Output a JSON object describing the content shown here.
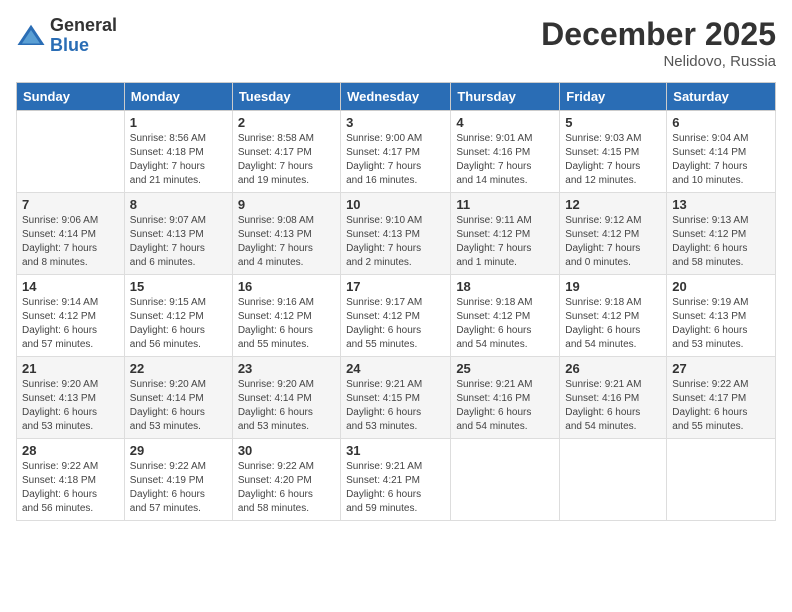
{
  "header": {
    "logo_general": "General",
    "logo_blue": "Blue",
    "month_title": "December 2025",
    "location": "Nelidovo, Russia"
  },
  "columns": [
    "Sunday",
    "Monday",
    "Tuesday",
    "Wednesday",
    "Thursday",
    "Friday",
    "Saturday"
  ],
  "weeks": [
    [
      {
        "day": "",
        "info": ""
      },
      {
        "day": "1",
        "info": "Sunrise: 8:56 AM\nSunset: 4:18 PM\nDaylight: 7 hours\nand 21 minutes."
      },
      {
        "day": "2",
        "info": "Sunrise: 8:58 AM\nSunset: 4:17 PM\nDaylight: 7 hours\nand 19 minutes."
      },
      {
        "day": "3",
        "info": "Sunrise: 9:00 AM\nSunset: 4:17 PM\nDaylight: 7 hours\nand 16 minutes."
      },
      {
        "day": "4",
        "info": "Sunrise: 9:01 AM\nSunset: 4:16 PM\nDaylight: 7 hours\nand 14 minutes."
      },
      {
        "day": "5",
        "info": "Sunrise: 9:03 AM\nSunset: 4:15 PM\nDaylight: 7 hours\nand 12 minutes."
      },
      {
        "day": "6",
        "info": "Sunrise: 9:04 AM\nSunset: 4:14 PM\nDaylight: 7 hours\nand 10 minutes."
      }
    ],
    [
      {
        "day": "7",
        "info": "Sunrise: 9:06 AM\nSunset: 4:14 PM\nDaylight: 7 hours\nand 8 minutes."
      },
      {
        "day": "8",
        "info": "Sunrise: 9:07 AM\nSunset: 4:13 PM\nDaylight: 7 hours\nand 6 minutes."
      },
      {
        "day": "9",
        "info": "Sunrise: 9:08 AM\nSunset: 4:13 PM\nDaylight: 7 hours\nand 4 minutes."
      },
      {
        "day": "10",
        "info": "Sunrise: 9:10 AM\nSunset: 4:13 PM\nDaylight: 7 hours\nand 2 minutes."
      },
      {
        "day": "11",
        "info": "Sunrise: 9:11 AM\nSunset: 4:12 PM\nDaylight: 7 hours\nand 1 minute."
      },
      {
        "day": "12",
        "info": "Sunrise: 9:12 AM\nSunset: 4:12 PM\nDaylight: 7 hours\nand 0 minutes."
      },
      {
        "day": "13",
        "info": "Sunrise: 9:13 AM\nSunset: 4:12 PM\nDaylight: 6 hours\nand 58 minutes."
      }
    ],
    [
      {
        "day": "14",
        "info": "Sunrise: 9:14 AM\nSunset: 4:12 PM\nDaylight: 6 hours\nand 57 minutes."
      },
      {
        "day": "15",
        "info": "Sunrise: 9:15 AM\nSunset: 4:12 PM\nDaylight: 6 hours\nand 56 minutes."
      },
      {
        "day": "16",
        "info": "Sunrise: 9:16 AM\nSunset: 4:12 PM\nDaylight: 6 hours\nand 55 minutes."
      },
      {
        "day": "17",
        "info": "Sunrise: 9:17 AM\nSunset: 4:12 PM\nDaylight: 6 hours\nand 55 minutes."
      },
      {
        "day": "18",
        "info": "Sunrise: 9:18 AM\nSunset: 4:12 PM\nDaylight: 6 hours\nand 54 minutes."
      },
      {
        "day": "19",
        "info": "Sunrise: 9:18 AM\nSunset: 4:12 PM\nDaylight: 6 hours\nand 54 minutes."
      },
      {
        "day": "20",
        "info": "Sunrise: 9:19 AM\nSunset: 4:13 PM\nDaylight: 6 hours\nand 53 minutes."
      }
    ],
    [
      {
        "day": "21",
        "info": "Sunrise: 9:20 AM\nSunset: 4:13 PM\nDaylight: 6 hours\nand 53 minutes."
      },
      {
        "day": "22",
        "info": "Sunrise: 9:20 AM\nSunset: 4:14 PM\nDaylight: 6 hours\nand 53 minutes."
      },
      {
        "day": "23",
        "info": "Sunrise: 9:20 AM\nSunset: 4:14 PM\nDaylight: 6 hours\nand 53 minutes."
      },
      {
        "day": "24",
        "info": "Sunrise: 9:21 AM\nSunset: 4:15 PM\nDaylight: 6 hours\nand 53 minutes."
      },
      {
        "day": "25",
        "info": "Sunrise: 9:21 AM\nSunset: 4:16 PM\nDaylight: 6 hours\nand 54 minutes."
      },
      {
        "day": "26",
        "info": "Sunrise: 9:21 AM\nSunset: 4:16 PM\nDaylight: 6 hours\nand 54 minutes."
      },
      {
        "day": "27",
        "info": "Sunrise: 9:22 AM\nSunset: 4:17 PM\nDaylight: 6 hours\nand 55 minutes."
      }
    ],
    [
      {
        "day": "28",
        "info": "Sunrise: 9:22 AM\nSunset: 4:18 PM\nDaylight: 6 hours\nand 56 minutes."
      },
      {
        "day": "29",
        "info": "Sunrise: 9:22 AM\nSunset: 4:19 PM\nDaylight: 6 hours\nand 57 minutes."
      },
      {
        "day": "30",
        "info": "Sunrise: 9:22 AM\nSunset: 4:20 PM\nDaylight: 6 hours\nand 58 minutes."
      },
      {
        "day": "31",
        "info": "Sunrise: 9:21 AM\nSunset: 4:21 PM\nDaylight: 6 hours\nand 59 minutes."
      },
      {
        "day": "",
        "info": ""
      },
      {
        "day": "",
        "info": ""
      },
      {
        "day": "",
        "info": ""
      }
    ]
  ]
}
